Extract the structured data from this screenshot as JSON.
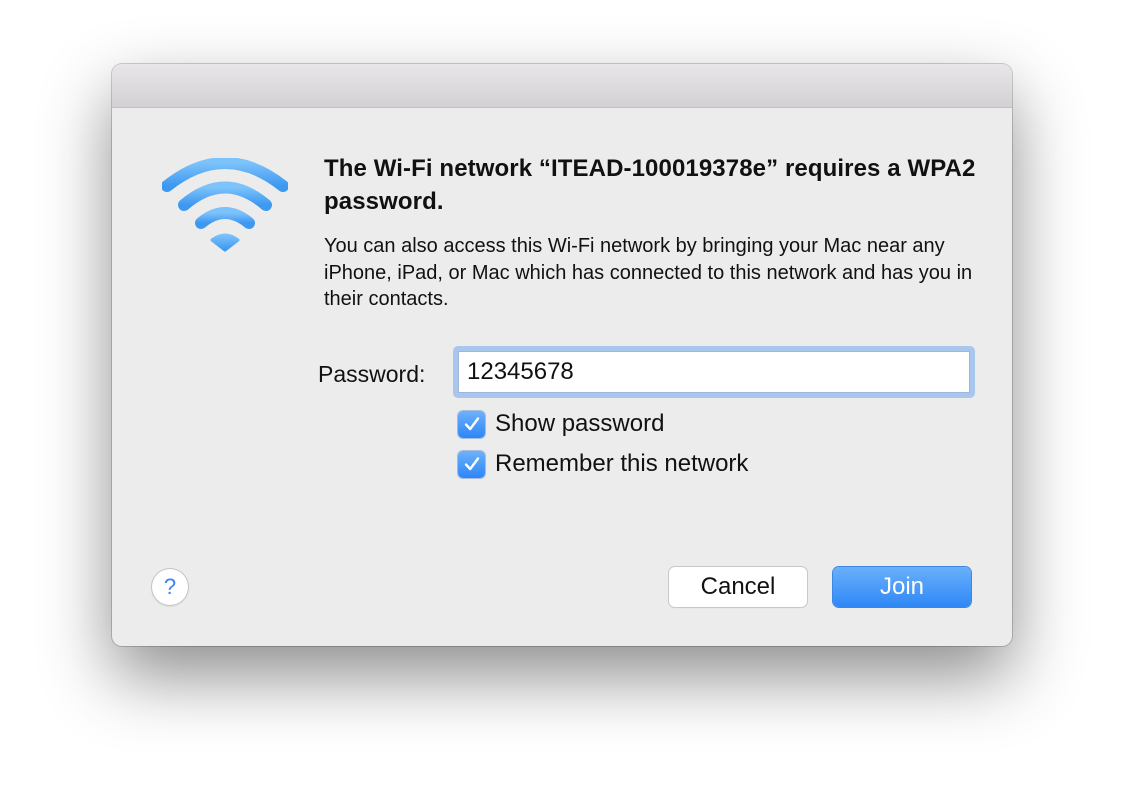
{
  "dialog": {
    "heading": "The Wi-Fi network “ITEAD-100019378e” requires a WPA2 password.",
    "description": "You can also access this Wi-Fi network by bringing your Mac near any iPhone, iPad, or Mac which has connected to this network and has you in their contacts.",
    "icon": "wifi-icon"
  },
  "password": {
    "label": "Password:",
    "value": "12345678"
  },
  "options": {
    "show_password": {
      "label": "Show password",
      "checked": true
    },
    "remember_network": {
      "label": "Remember this network",
      "checked": true
    }
  },
  "buttons": {
    "help": "?",
    "cancel": "Cancel",
    "join": "Join"
  },
  "colors": {
    "accent": "#3b8cf5",
    "wifi_icon": "#5aaef5",
    "background": "#ececec"
  }
}
